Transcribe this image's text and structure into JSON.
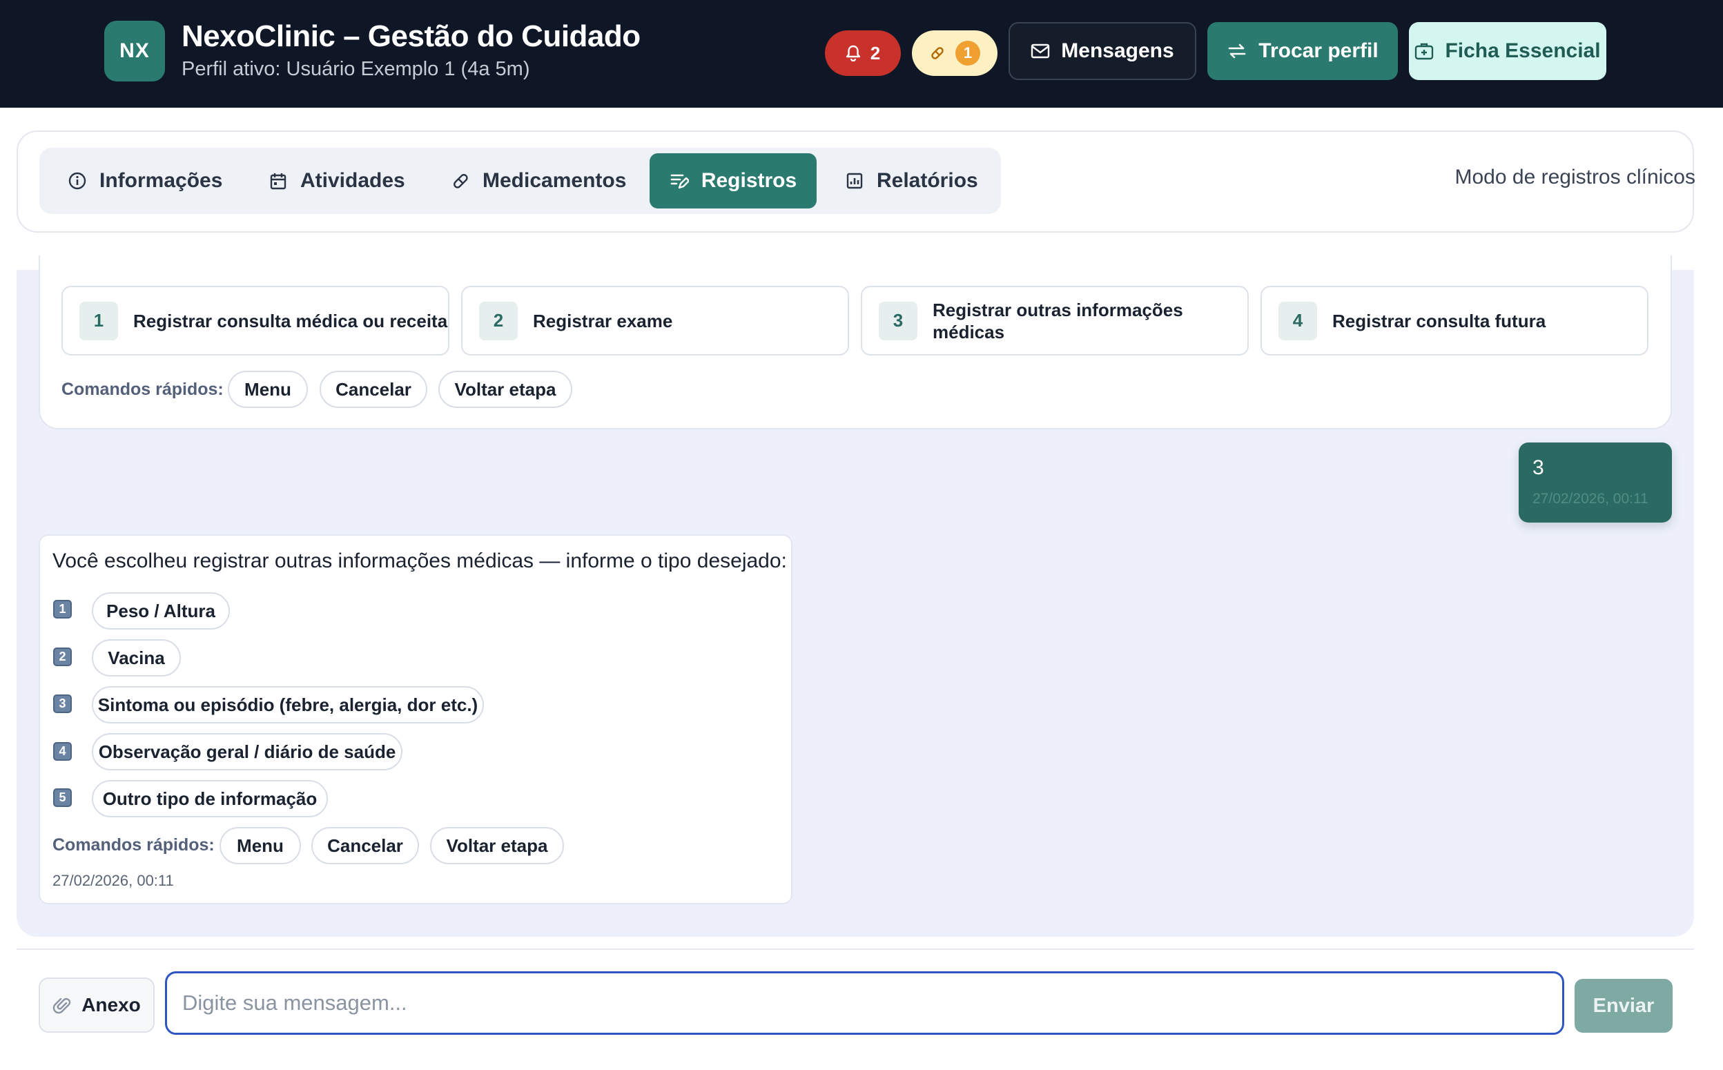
{
  "header": {
    "logo_text": "NX",
    "title": "NexoClinic – Gestão do Cuidado",
    "subtitle": "Perfil ativo: Usuário Exemplo 1 (4a 5m)",
    "alerts_count": "2",
    "medication_count": "1",
    "messages_label": "Mensagens",
    "switch_profile_label": "Trocar perfil",
    "essential_record_label": "Ficha Essencial",
    "colors": {
      "bar": "#0f1726",
      "accent": "#2b7a6f",
      "alert": "#c8322a",
      "warning_bg": "#fdf0c2"
    }
  },
  "tabs": {
    "items": [
      {
        "label": "Informações",
        "icon": "info-icon",
        "active": false
      },
      {
        "label": "Atividades",
        "icon": "calendar-icon",
        "active": false
      },
      {
        "label": "Medicamentos",
        "icon": "pill-icon",
        "active": false
      },
      {
        "label": "Registros",
        "icon": "edit-list-icon",
        "active": true
      },
      {
        "label": "Relatórios",
        "icon": "report-chart-icon",
        "active": false
      }
    ],
    "mode_label": "Modo de registros clínicos"
  },
  "chat": {
    "menu_steps": [
      {
        "number": "1",
        "label": "Registrar consulta médica ou receita"
      },
      {
        "number": "2",
        "label": "Registrar exame"
      },
      {
        "number": "3",
        "label": "Registrar outras informações médicas"
      },
      {
        "number": "4",
        "label": "Registrar consulta futura"
      }
    ],
    "quick_commands_label": "Comandos rápidos:",
    "quick_commands": [
      "Menu",
      "Cancelar",
      "Voltar etapa"
    ],
    "user_message": {
      "text": "3",
      "time": "27/02/2026, 00:11"
    },
    "bot_message": {
      "text": "Você escolheu registrar outras informações médicas — informe o tipo desejado:",
      "options": [
        {
          "key": "1",
          "label": "Peso / Altura"
        },
        {
          "key": "2",
          "label": "Vacina"
        },
        {
          "key": "3",
          "label": "Sintoma ou episódio (febre, alergia, dor etc.)"
        },
        {
          "key": "4",
          "label": "Observação geral / diário de saúde"
        },
        {
          "key": "5",
          "label": "Outro tipo de informação"
        }
      ],
      "time": "27/02/2026, 00:11"
    }
  },
  "composer": {
    "attach_label": "Anexo",
    "input_value": "",
    "input_placeholder": "Digite sua mensagem...",
    "send_label": "Enviar"
  }
}
